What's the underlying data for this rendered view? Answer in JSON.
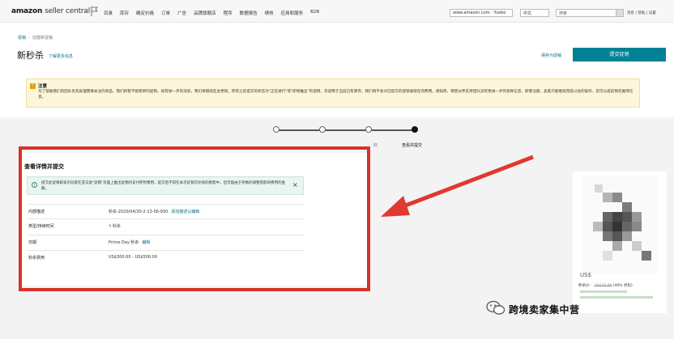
{
  "header": {
    "logo_main": "amazon",
    "logo_sub": "seller central",
    "nav": [
      "目录",
      "库存",
      "确定价格",
      "订单",
      "广告",
      "品牌旗舰店",
      "程序",
      "数据报告",
      "绩效",
      "应用和服务",
      "B2B"
    ],
    "url_value": "www.amazon.com - Yuebo",
    "lang_value": "中文",
    "search_placeholder": "搜索",
    "top_links": "消息 | 帮助 | 设置"
  },
  "breadcrumb": {
    "first": "促销",
    "current": "创建新促销"
  },
  "page": {
    "title": "新秒杀",
    "learn_more": "了解更多信息",
    "save_draft": "保存为促销",
    "submit": "提交促销"
  },
  "notice": {
    "title": "注意",
    "body": "为了帮助我们的团队优先处理需要关注的商品，我们将暂不接受新的促销。如有进一步的消息，我们将继续在此更新。所有之前提交的状态为\"正在进行\"或\"即将推出\"的促销，仅适用于当前已有库存。我们将不会对已提交的促销收取任何费用。请知悉，销售伙伴支持团队没有更进一步的指导信息，即使注册，卖家只能继续完成以往的操作，您可以提前预先维持信息。"
  },
  "stepper": {
    "partial_label": "商",
    "current_label": "查看并提交"
  },
  "review": {
    "title": "查看详情并提交",
    "info_text": "提交此促销即表示同意在亚马逊\"促销\"页面上推出促销时支付所列费用。提交后不得在本次促销可达到的销售中，但可能由于参数的调整而影响费用的金额。",
    "rows": [
      {
        "key": "内部描述",
        "value": "秒杀-2020/04/30-2-13-56-930",
        "action": "添加描述以编辑"
      },
      {
        "key": "类型/持续时间",
        "value": "秒杀",
        "action": ""
      },
      {
        "key": "日期",
        "value": "Prime Day 秒杀",
        "action": "编辑"
      },
      {
        "key": "秒杀费用",
        "value": "US$300.00 - US$500.00",
        "action": ""
      }
    ]
  },
  "product": {
    "us_label": "US$",
    "price_label": "秒杀价：",
    "price_old": "US$20.99",
    "price_discount": "(40% 折扣)"
  },
  "watermark": "跨境卖家集中营",
  "colors": {
    "accent": "#008296",
    "link": "#0a6f86",
    "highlight_frame": "#d9312b"
  }
}
